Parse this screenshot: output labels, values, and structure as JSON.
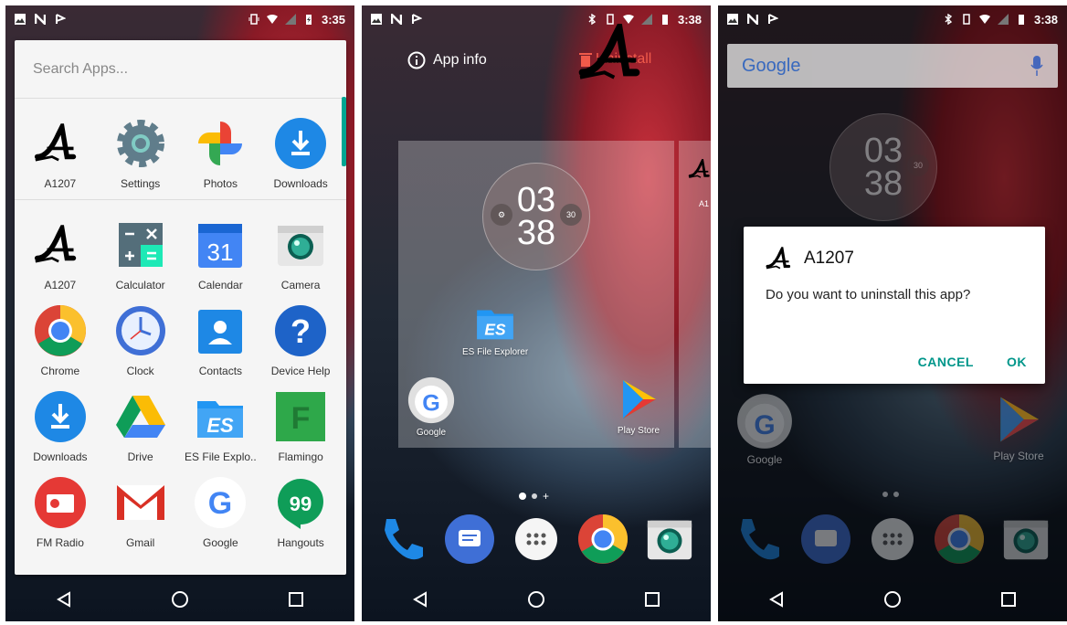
{
  "panel1": {
    "status": {
      "time": "3:35"
    },
    "search": {
      "placeholder": "Search Apps..."
    },
    "suggested": [
      {
        "label": "A1207",
        "icon": "a1207-logo-icon"
      },
      {
        "label": "Settings",
        "icon": "settings-gear-icon"
      },
      {
        "label": "Photos",
        "icon": "photos-pinwheel-icon"
      },
      {
        "label": "Downloads",
        "icon": "downloads-icon"
      }
    ],
    "rows": [
      [
        {
          "label": "A1207",
          "icon": "a1207-logo-icon"
        },
        {
          "label": "Calculator",
          "icon": "calculator-icon"
        },
        {
          "label": "Calendar",
          "icon": "calendar-icon",
          "text": "31"
        },
        {
          "label": "Camera",
          "icon": "camera-icon"
        }
      ],
      [
        {
          "label": "Chrome",
          "icon": "chrome-icon"
        },
        {
          "label": "Clock",
          "icon": "clock-icon"
        },
        {
          "label": "Contacts",
          "icon": "contacts-icon"
        },
        {
          "label": "Device Help",
          "icon": "device-help-icon",
          "text": "?"
        }
      ],
      [
        {
          "label": "Downloads",
          "icon": "downloads-icon"
        },
        {
          "label": "Drive",
          "icon": "drive-icon"
        },
        {
          "label": "ES File Explo..",
          "icon": "es-file-explorer-icon"
        },
        {
          "label": "Flamingo",
          "icon": "flamingo-icon",
          "text": "F"
        }
      ],
      [
        {
          "label": "FM Radio",
          "icon": "fm-radio-icon"
        },
        {
          "label": "Gmail",
          "icon": "gmail-icon"
        },
        {
          "label": "Google",
          "icon": "google-icon",
          "text": "G"
        },
        {
          "label": "Hangouts",
          "icon": "hangouts-icon",
          "text": "99"
        }
      ]
    ]
  },
  "panel2": {
    "status": {
      "time": "3:38"
    },
    "app_info_label": "App info",
    "uninstall_label": "Uninstall",
    "clock": {
      "hour": "03",
      "minute": "38",
      "left_dot": "⚙",
      "right_dot": "30"
    },
    "home_apps": [
      {
        "label": "ES File Explorer",
        "icon": "es-file-explorer-icon"
      },
      {
        "label": "Google",
        "icon": "google-folder-icon"
      },
      {
        "label": "Play Store",
        "icon": "play-store-icon"
      }
    ],
    "side_preview_label": "A1",
    "dock": [
      "phone-icon",
      "messages-icon",
      "app-drawer-icon",
      "chrome-icon",
      "camera-icon"
    ]
  },
  "panel3": {
    "status": {
      "time": "3:38"
    },
    "google_bar_text": "Google",
    "clock": {
      "hour": "03",
      "minute": "38",
      "right_dot": "30"
    },
    "dialog": {
      "title": "A1207",
      "message": "Do you want to uninstall this app?",
      "cancel": "CANCEL",
      "ok": "OK"
    },
    "home_apps": [
      {
        "label": "Google",
        "icon": "google-folder-icon"
      },
      {
        "label": "Play Store",
        "icon": "play-store-icon"
      }
    ]
  },
  "colors": {
    "accent_teal": "#00968a",
    "uninstall_red": "#f05a4a",
    "drawer_bg": "#f5f5f5"
  }
}
